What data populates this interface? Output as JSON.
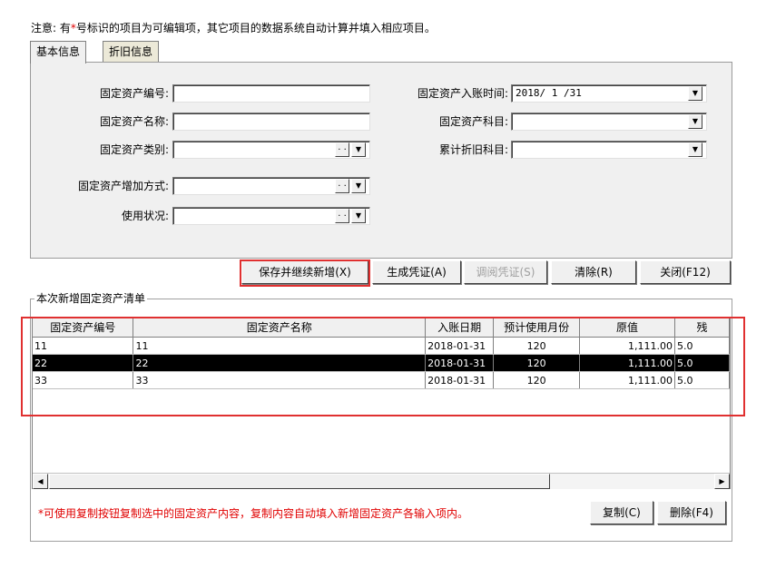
{
  "notice": {
    "prefix": "注意: 有",
    "star": "*",
    "suffix": "号标识的项目为可编辑项，其它项目的数据系统自动计算并填入相应项目。"
  },
  "tabs": [
    {
      "label": "基本信息",
      "active": true
    },
    {
      "label": "折旧信息",
      "active": false
    }
  ],
  "form": {
    "asset_code": {
      "label": "固定资产编号:",
      "value": ""
    },
    "asset_name": {
      "label": "固定资产名称:",
      "value": ""
    },
    "asset_category": {
      "label": "固定资产类别:",
      "value": ""
    },
    "increase_method": {
      "label": "固定资产增加方式:",
      "value": ""
    },
    "usage_status": {
      "label": "使用状况:",
      "value": ""
    },
    "entry_time": {
      "label": "固定资产入账时间:",
      "value": "2018/ 1 /31"
    },
    "asset_account": {
      "label": "固定资产科目:",
      "value": ""
    },
    "depreciation_account": {
      "label": "累计折旧科目:",
      "value": ""
    },
    "dots_glyph": ". .",
    "arrow_glyph": "▼"
  },
  "actions": {
    "save_continue": "保存并继续新增(X)",
    "gen_voucher": "生成凭证(A)",
    "view_voucher": "调阅凭证(S)",
    "clear": "清除(R)",
    "close": "关闭(F12)"
  },
  "list": {
    "title": "本次新增固定资产清单",
    "columns": [
      "固定资产编号",
      "固定资产名称",
      "入账日期",
      "预计使用月份",
      "原值",
      "残"
    ],
    "rows": [
      {
        "code": "11",
        "name": "11",
        "date": "2018-01-31",
        "months": "120",
        "value": "1,111.00",
        "residual": "5.0",
        "selected": false
      },
      {
        "code": "22",
        "name": "22",
        "date": "2018-01-31",
        "months": "120",
        "value": "1,111.00",
        "residual": "5.0",
        "selected": true
      },
      {
        "code": "33",
        "name": "33",
        "date": "2018-01-31",
        "months": "120",
        "value": "1,111.00",
        "residual": "5.0",
        "selected": false
      }
    ]
  },
  "scroll": {
    "left_glyph": "◀",
    "right_glyph": "▶"
  },
  "footer": {
    "hint": "*可使用复制按钮复制选中的固定资产内容，复制内容自动填入新增固定资产各输入项内。",
    "copy": "复制(C)",
    "delete": "删除(F4)"
  },
  "colors": {
    "highlight": "#e03030",
    "notice_star": "#e00000",
    "selected_row": "#000000"
  }
}
